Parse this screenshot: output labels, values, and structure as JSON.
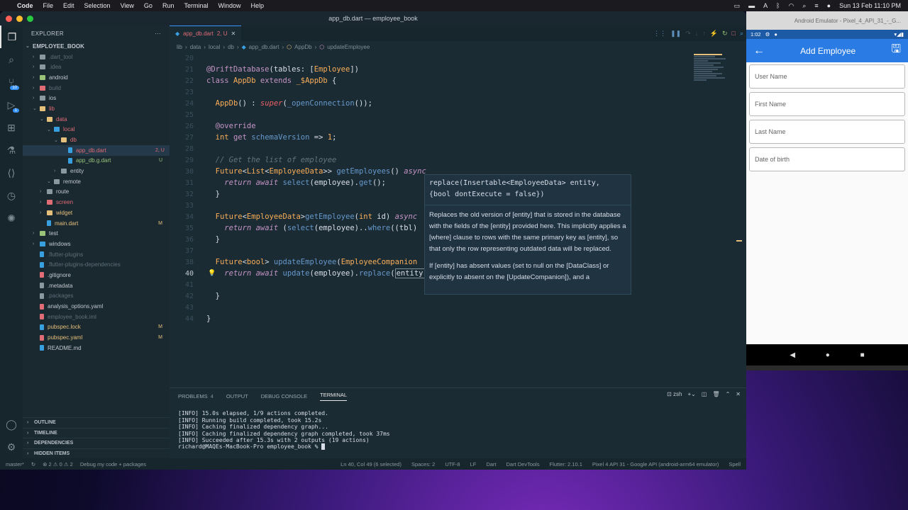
{
  "menubar": {
    "items": [
      "Code",
      "File",
      "Edit",
      "Selection",
      "View",
      "Go",
      "Run",
      "Terminal",
      "Window",
      "Help"
    ],
    "datetime": "Sun 13 Feb  11:10 PM"
  },
  "window": {
    "title": "app_db.dart — employee_book"
  },
  "activity": {
    "scm_badge": "10",
    "debug_badge": "1"
  },
  "explorer": {
    "header": "EXPLORER",
    "root": "EMPLOYEE_BOOK",
    "items": [
      {
        "label": ".dart_tool",
        "status": ""
      },
      {
        "label": ".idea",
        "status": ""
      },
      {
        "label": "android",
        "status": ""
      },
      {
        "label": "build",
        "status": ""
      },
      {
        "label": "ios",
        "status": ""
      },
      {
        "label": "lib",
        "status": ""
      },
      {
        "label": "data",
        "status": ""
      },
      {
        "label": "local",
        "status": ""
      },
      {
        "label": "db",
        "status": ""
      },
      {
        "label": "app_db.dart",
        "status": "2, U"
      },
      {
        "label": "app_db.g.dart",
        "status": "U"
      },
      {
        "label": "entity",
        "status": ""
      },
      {
        "label": "remote",
        "status": ""
      },
      {
        "label": "route",
        "status": ""
      },
      {
        "label": "screen",
        "status": ""
      },
      {
        "label": "widget",
        "status": ""
      },
      {
        "label": "main.dart",
        "status": "M"
      },
      {
        "label": "test",
        "status": ""
      },
      {
        "label": "windows",
        "status": ""
      },
      {
        "label": ".flutter-plugins",
        "status": ""
      },
      {
        "label": ".flutter-plugins-dependencies",
        "status": ""
      },
      {
        "label": ".gitignore",
        "status": ""
      },
      {
        "label": ".metadata",
        "status": ""
      },
      {
        "label": ".packages",
        "status": ""
      },
      {
        "label": "analysis_options.yaml",
        "status": ""
      },
      {
        "label": "employee_book.iml",
        "status": ""
      },
      {
        "label": "pubspec.lock",
        "status": "M"
      },
      {
        "label": "pubspec.yaml",
        "status": "M"
      },
      {
        "label": "README.md",
        "status": ""
      }
    ],
    "sections": [
      "OUTLINE",
      "TIMELINE",
      "DEPENDENCIES",
      "HIDDEN ITEMS"
    ]
  },
  "editor": {
    "tab_label": "app_db.dart",
    "tab_status": "2, U",
    "breadcrumbs": [
      "lib",
      "data",
      "local",
      "db",
      "app_db.dart",
      "AppDb",
      "updateEmployee"
    ],
    "line_numbers": [
      "20",
      "21",
      "22",
      "23",
      "24",
      "25",
      "26",
      "27",
      "28",
      "29",
      "30",
      "31",
      "32",
      "33",
      "34",
      "35",
      "36",
      "37",
      "38",
      "39",
      "40",
      "41",
      "42",
      "43",
      "44"
    ],
    "current_line": "40"
  },
  "hover": {
    "signature_1": "replace(Insertable<EmployeeData> entity,",
    "signature_2": "{bool dontExecute = false})",
    "doc_1": "Replaces the old version of [entity] that is stored in the database with the fields of the [entity] provided here. This implicitly applies a [where] clause to rows with the same primary key as [entity], so that only the row representing outdated data will be replaced.",
    "doc_2": "If [entity] has absent values (set to null on the [DataClass] or explicitly to absent on the [UpdateCompanion]), and a"
  },
  "panel": {
    "tabs": [
      {
        "label": "PROBLEMS",
        "count": "4"
      },
      {
        "label": "OUTPUT",
        "count": ""
      },
      {
        "label": "DEBUG CONSOLE",
        "count": ""
      },
      {
        "label": "TERMINAL",
        "count": ""
      }
    ],
    "shell": "zsh",
    "terminal_lines": [
      "[INFO] 15.0s elapsed, 1/9 actions completed.",
      "[INFO] Running build completed, took 15.2s",
      "",
      "[INFO] Caching finalized dependency graph...",
      "[INFO] Caching finalized dependency graph completed, took 37ms",
      "",
      "[INFO] Succeeded after 15.3s with 2 outputs (19 actions)",
      "",
      "richard@MAQEs-MacBook-Pro employee_book % "
    ]
  },
  "statusbar": {
    "branch": "master*",
    "problems": "⊗ 2  ⚠ 0  ⚠ 2",
    "debug": "Debug my code + packages",
    "position": "Ln 40, Col 49 (6 selected)",
    "spaces": "Spaces: 2",
    "encoding": "UTF-8",
    "eol": "LF",
    "language": "Dart",
    "devtools": "Dart DevTools",
    "flutter": "Flutter: 2.10.1",
    "device": "Pixel 4 API 31 - Google API (android-arm64 emulator)",
    "spell": "Spell"
  },
  "emulator": {
    "title": "Android Emulator - Pixel_4_API_31_-_G...",
    "time": "1:02",
    "appbar_title": "Add Employee",
    "fields": [
      "User Name",
      "First Name",
      "Last Name",
      "Date of birth"
    ]
  }
}
